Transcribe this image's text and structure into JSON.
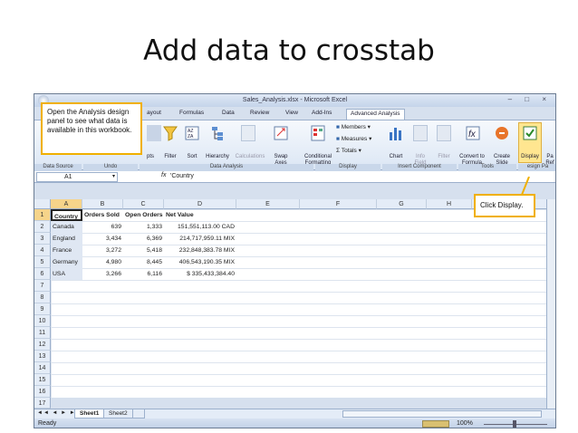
{
  "slide": {
    "title": "Add data to crosstab"
  },
  "window": {
    "title": "Sales_Analysis.xlsx - Microsoft Excel",
    "controls": "– □ ×"
  },
  "ribbon_tabs": [
    "ayout",
    "Formulas",
    "Data",
    "Review",
    "View",
    "Add-Ins",
    "Advanced Analysis"
  ],
  "ribbon": {
    "buttons": [
      {
        "label": "pts"
      },
      {
        "label": "Filter"
      },
      {
        "label": "Sort"
      },
      {
        "label": "Hierarchy"
      },
      {
        "label": "Calculations"
      },
      {
        "label": "Swap\nAxes"
      },
      {
        "label": "Conditional\nFormatting"
      },
      {
        "label": "Chart"
      },
      {
        "label": "Info\nField"
      },
      {
        "label": "Filter"
      },
      {
        "label": "Convert to\nFormula"
      },
      {
        "label": "Create\nSlide"
      },
      {
        "label": "Display"
      },
      {
        "label": "Pa\nRef"
      }
    ],
    "small_buttons": {
      "members": "Members",
      "measures": "Measures",
      "totals": "Totals"
    },
    "groups": [
      "Data Source",
      "Undo",
      "Data Analysis",
      "Display",
      "Insert Component",
      "Tools",
      "esign Pa"
    ]
  },
  "formula_bar": {
    "cell_ref": "A1",
    "fx": "fx",
    "value": "'Country"
  },
  "columns": [
    "A",
    "B",
    "C",
    "D",
    "E",
    "F",
    "G",
    "H"
  ],
  "rows": [
    "1",
    "2",
    "3",
    "4",
    "5",
    "6",
    "7",
    "8",
    "9",
    "10",
    "11",
    "12",
    "13",
    "14",
    "15",
    "16",
    "17"
  ],
  "table": {
    "headers": [
      "Country",
      "Orders Sold",
      "Open Orders",
      "Net Value"
    ],
    "rows": [
      [
        "Canada",
        "639",
        "1,333",
        "151,551,113.00 CAD"
      ],
      [
        "England",
        "3,434",
        "6,369",
        "214,717,959.11 MIX"
      ],
      [
        "France",
        "3,272",
        "5,418",
        "232,848,383.78 MIX"
      ],
      [
        "Germany",
        "4,980",
        "8,445",
        "406,543,190.35 MIX"
      ],
      [
        "USA",
        "3,266",
        "6,116",
        "$ 335,433,384.40"
      ]
    ]
  },
  "sheet_tabs": [
    "Sheet1",
    "Sheet2"
  ],
  "status": {
    "ready": "Ready",
    "zoom": "100%"
  },
  "callouts": {
    "analysis": "Open the Analysis design panel to see what data is available in this workbook.",
    "display": "Click Display."
  },
  "colors": {
    "callout_border": "#f0b000",
    "ribbon_bg": "#dbe6f4",
    "header_bg": "#e4ecf7"
  }
}
